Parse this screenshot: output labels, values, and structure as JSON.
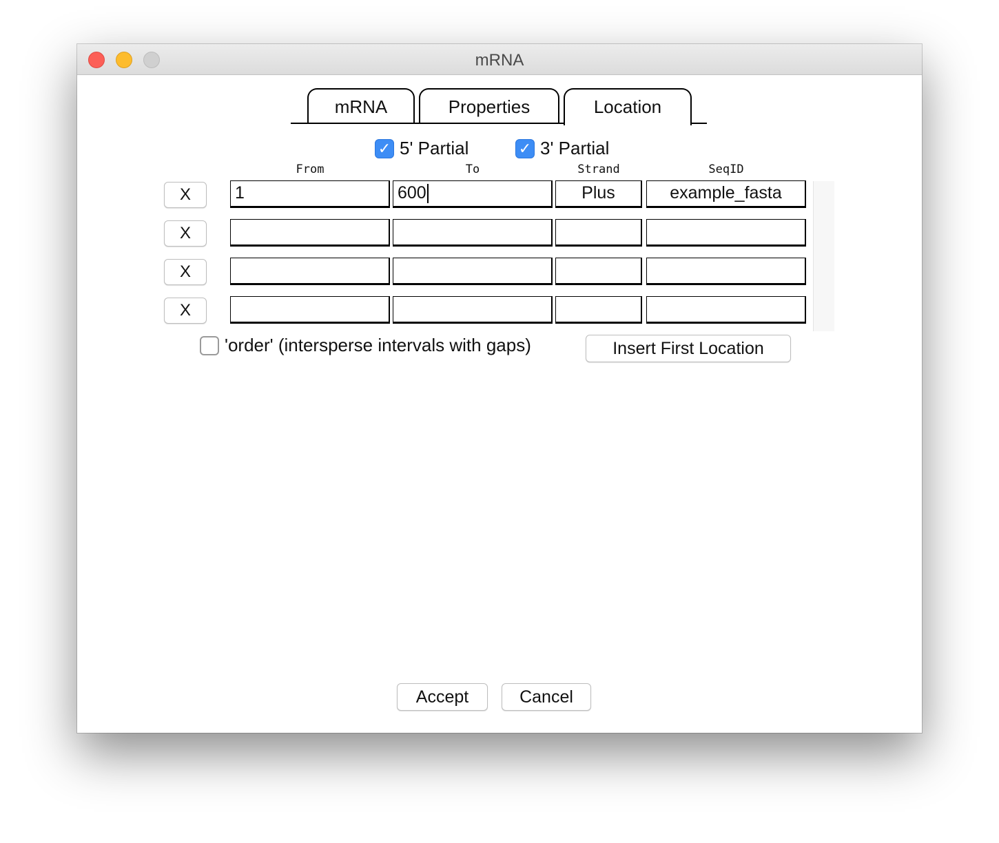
{
  "window": {
    "title": "mRNA"
  },
  "tabs": [
    {
      "label": "mRNA",
      "active": false
    },
    {
      "label": "Properties",
      "active": false
    },
    {
      "label": "Location",
      "active": true
    }
  ],
  "partial": {
    "five_prime": {
      "label": "5' Partial",
      "checked": true
    },
    "three_prime": {
      "label": "3' Partial",
      "checked": true
    }
  },
  "columns": [
    "From",
    "To",
    "Strand",
    "SeqID"
  ],
  "rows": [
    {
      "delete_label": "X",
      "from": "1",
      "to": "600",
      "strand": "Plus",
      "seqid": "example_fasta"
    },
    {
      "delete_label": "X",
      "from": "",
      "to": "",
      "strand": "",
      "seqid": ""
    },
    {
      "delete_label": "X",
      "from": "",
      "to": "",
      "strand": "",
      "seqid": ""
    },
    {
      "delete_label": "X",
      "from": "",
      "to": "",
      "strand": "",
      "seqid": ""
    }
  ],
  "order": {
    "label": "'order' (intersperse intervals with gaps)",
    "checked": false
  },
  "buttons": {
    "insert_first": "Insert First Location",
    "accept": "Accept",
    "cancel": "Cancel"
  },
  "colors": {
    "checkbox_accent": "#3d8df5",
    "close": "#fc5f57",
    "minimize": "#fdbc2e",
    "maximize_disabled": "#d0d0d0"
  },
  "icons": {
    "check": "checkmark-icon"
  }
}
